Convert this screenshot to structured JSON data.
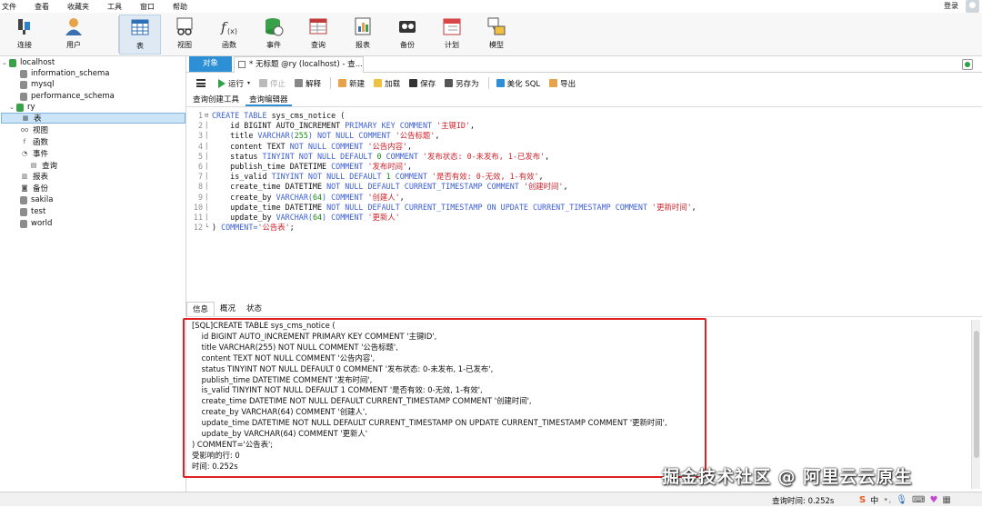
{
  "menu": [
    "文件",
    "查看",
    "收藏夹",
    "工具",
    "窗口",
    "帮助"
  ],
  "login": "登录",
  "toolbar": [
    {
      "label": "连接",
      "icon": "plug-icon"
    },
    {
      "label": "用户",
      "icon": "user-icon"
    },
    {
      "label": "表",
      "icon": "table-icon"
    },
    {
      "label": "视图",
      "icon": "view-icon"
    },
    {
      "label": "函数",
      "icon": "function-icon"
    },
    {
      "label": "事件",
      "icon": "event-icon"
    },
    {
      "label": "查询",
      "icon": "query-icon"
    },
    {
      "label": "报表",
      "icon": "report-icon"
    },
    {
      "label": "备份",
      "icon": "backup-icon"
    },
    {
      "label": "计划",
      "icon": "schedule-icon"
    },
    {
      "label": "模型",
      "icon": "model-icon"
    }
  ],
  "tree": {
    "root": "localhost",
    "dbs": [
      "information_schema",
      "mysql",
      "performance_schema"
    ],
    "open_db": "ry",
    "children": [
      "表",
      "视图",
      "函数",
      "事件",
      "查询",
      "报表",
      "备份"
    ],
    "more_dbs": [
      "sakila",
      "test",
      "world"
    ]
  },
  "tabs": {
    "objects": "对象",
    "query": "* 无标题 @ry (localhost) - 查..."
  },
  "query_toolbar": {
    "run": "运行",
    "stop": "停止",
    "explain": "解释",
    "new": "新建",
    "load": "加载",
    "save": "保存",
    "save_as": "另存为",
    "beautify": "美化 SQL",
    "export": "导出"
  },
  "subtabs": [
    "查询创建工具",
    "查询编辑器"
  ],
  "editor_lines": [
    [
      [
        "kw",
        "CREATE TABLE "
      ],
      [
        "plain",
        "sys_cms_notice ("
      ]
    ],
    [
      [
        "plain",
        "    id BIGINT AUTO_INCREMENT "
      ],
      [
        "kw",
        "PRIMARY KEY COMMENT "
      ],
      [
        "str",
        "'主键ID'"
      ],
      [
        "plain",
        ","
      ]
    ],
    [
      [
        "plain",
        "    title "
      ],
      [
        "kw",
        "VARCHAR("
      ],
      [
        "num",
        "255"
      ],
      [
        "kw",
        ") NOT NULL COMMENT "
      ],
      [
        "str",
        "'公告标题'"
      ],
      [
        "plain",
        ","
      ]
    ],
    [
      [
        "plain",
        "    content TEXT "
      ],
      [
        "kw",
        "NOT NULL COMMENT "
      ],
      [
        "str",
        "'公告内容'"
      ],
      [
        "plain",
        ","
      ]
    ],
    [
      [
        "plain",
        "    status "
      ],
      [
        "kw",
        "TINYINT NOT NULL DEFAULT "
      ],
      [
        "num",
        "0"
      ],
      [
        "kw",
        " COMMENT "
      ],
      [
        "str",
        "'发布状态: 0-未发布, 1-已发布'"
      ],
      [
        "plain",
        ","
      ]
    ],
    [
      [
        "plain",
        "    publish_time DATETIME "
      ],
      [
        "kw",
        "COMMENT "
      ],
      [
        "str",
        "'发布时间'"
      ],
      [
        "plain",
        ","
      ]
    ],
    [
      [
        "plain",
        "    is_valid "
      ],
      [
        "kw",
        "TINYINT NOT NULL DEFAULT "
      ],
      [
        "num",
        "1"
      ],
      [
        "kw",
        " COMMENT "
      ],
      [
        "str",
        "'是否有效: 0-无效, 1-有效'"
      ],
      [
        "plain",
        ","
      ]
    ],
    [
      [
        "plain",
        "    create_time DATETIME "
      ],
      [
        "kw",
        "NOT NULL DEFAULT CURRENT_TIMESTAMP COMMENT "
      ],
      [
        "str",
        "'创建时间'"
      ],
      [
        "plain",
        ","
      ]
    ],
    [
      [
        "plain",
        "    create_by "
      ],
      [
        "kw",
        "VARCHAR("
      ],
      [
        "num",
        "64"
      ],
      [
        "kw",
        ") COMMENT "
      ],
      [
        "str",
        "'创建人'"
      ],
      [
        "plain",
        ","
      ]
    ],
    [
      [
        "plain",
        "    update_time DATETIME "
      ],
      [
        "kw",
        "NOT NULL DEFAULT CURRENT_TIMESTAMP ON UPDATE CURRENT_TIMESTAMP COMMENT "
      ],
      [
        "str",
        "'更新时间'"
      ],
      [
        "plain",
        ","
      ]
    ],
    [
      [
        "plain",
        "    update_by "
      ],
      [
        "kw",
        "VARCHAR("
      ],
      [
        "num",
        "64"
      ],
      [
        "kw",
        ") COMMENT "
      ],
      [
        "str",
        "'更新人'"
      ]
    ],
    [
      [
        "plain",
        ") "
      ],
      [
        "kw",
        "COMMENT="
      ],
      [
        "str",
        "'公告表'"
      ],
      [
        "plain",
        ";"
      ]
    ]
  ],
  "bottom_tabs": [
    "信息",
    "概况",
    "状态"
  ],
  "info_lines": [
    "[SQL]CREATE TABLE sys_cms_notice (",
    "    id BIGINT AUTO_INCREMENT PRIMARY KEY COMMENT '主键ID',",
    "    title VARCHAR(255) NOT NULL COMMENT '公告标题',",
    "    content TEXT NOT NULL COMMENT '公告内容',",
    "    status TINYINT NOT NULL DEFAULT 0 COMMENT '发布状态: 0-未发布, 1-已发布',",
    "    publish_time DATETIME COMMENT '发布时间',",
    "    is_valid TINYINT NOT NULL DEFAULT 1 COMMENT '是否有效: 0-无效, 1-有效',",
    "    create_time DATETIME NOT NULL DEFAULT CURRENT_TIMESTAMP COMMENT '创建时间',",
    "    create_by VARCHAR(64) COMMENT '创建人',",
    "    update_time DATETIME NOT NULL DEFAULT CURRENT_TIMESTAMP ON UPDATE CURRENT_TIMESTAMP COMMENT '更新时间',",
    "    update_by VARCHAR(64) COMMENT '更新人'",
    ") COMMENT='公告表';",
    "受影响的行: 0",
    "时间: 0.252s"
  ],
  "status": {
    "query_time": "查询时间: 0.252s"
  },
  "watermark": "掘金技术社区 @ 阿里云云原生",
  "tray": [
    "中"
  ],
  "colors": {
    "accent": "#2d8fd5",
    "highlight_box": "#e02020",
    "keyword": "#3d5fd2",
    "string": "#d0232a",
    "number": "#1a8b1a"
  }
}
